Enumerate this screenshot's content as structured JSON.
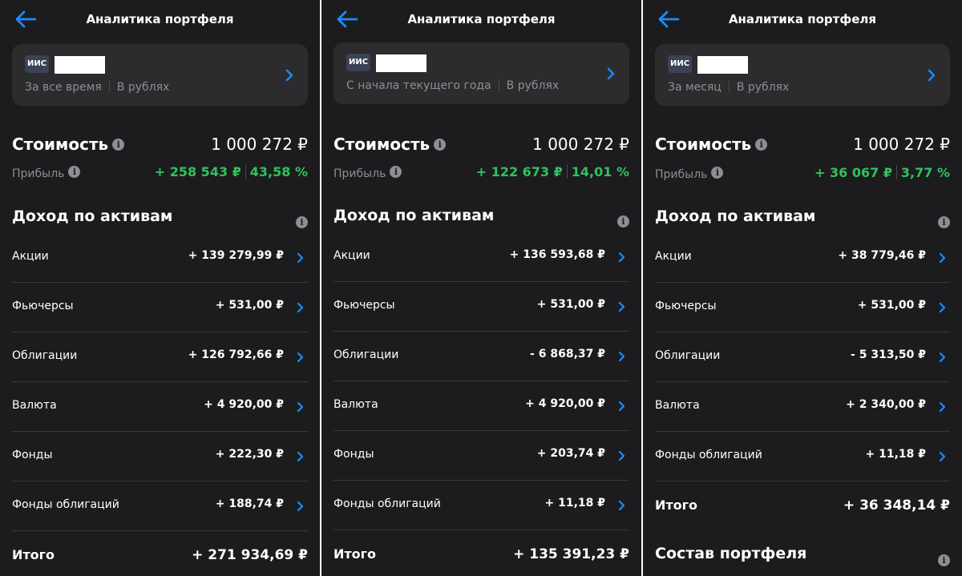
{
  "accent_color": "#1a8cff",
  "positive_color": "#30c25b",
  "icons": {
    "back": "arrow-left-icon",
    "chevron": "chevron-right-icon",
    "info": "info-icon"
  },
  "screens": [
    {
      "header_title": "Аналитика портфеля",
      "account_badge": "ИИС",
      "period": "За все время",
      "currency": "В рублях",
      "value_label": "Стоимость",
      "value": "1 000 272 ₽",
      "profit_label": "Прибыль",
      "profit_amount": "+ 258 543 ₽",
      "profit_percent": "43,58 %",
      "section_title": "Доход по активам",
      "assets": [
        {
          "name": "Акции",
          "value": "+ 139 279,99 ₽"
        },
        {
          "name": "Фьючерсы",
          "value": "+ 531,00 ₽"
        },
        {
          "name": "Облигации",
          "value": "+ 126 792,66 ₽"
        },
        {
          "name": "Валюта",
          "value": "+ 4 920,00 ₽"
        },
        {
          "name": "Фонды",
          "value": "+ 222,30 ₽"
        },
        {
          "name": "Фонды облигаций",
          "value": "+ 188,74 ₽"
        }
      ],
      "total_label": "Итого",
      "total_value": "+ 271 934,69 ₽"
    },
    {
      "header_title": "Аналитика портфеля",
      "account_badge": "ИИС",
      "period": "С начала текущего года",
      "currency": "В рублях",
      "value_label": "Стоимость",
      "value": "1 000 272 ₽",
      "profit_label": "Прибыль",
      "profit_amount": "+ 122 673 ₽",
      "profit_percent": "14,01 %",
      "section_title": "Доход по активам",
      "assets": [
        {
          "name": "Акции",
          "value": "+ 136 593,68 ₽"
        },
        {
          "name": "Фьючерсы",
          "value": "+ 531,00 ₽"
        },
        {
          "name": "Облигации",
          "value": "- 6 868,37 ₽"
        },
        {
          "name": "Валюта",
          "value": "+ 4 920,00 ₽"
        },
        {
          "name": "Фонды",
          "value": "+ 203,74 ₽"
        },
        {
          "name": "Фонды облигаций",
          "value": "+ 11,18 ₽"
        }
      ],
      "total_label": "Итого",
      "total_value": "+ 135 391,23 ₽"
    },
    {
      "header_title": "Аналитика портфеля",
      "account_badge": "ИИС",
      "period": "За месяц",
      "currency": "В рублях",
      "value_label": "Стоимость",
      "value": "1 000 272 ₽",
      "profit_label": "Прибыль",
      "profit_amount": "+ 36 067 ₽",
      "profit_percent": "3,77 %",
      "section_title": "Доход по активам",
      "assets": [
        {
          "name": "Акции",
          "value": "+ 38 779,46 ₽"
        },
        {
          "name": "Фьючерсы",
          "value": "+ 531,00 ₽"
        },
        {
          "name": "Облигации",
          "value": "- 5 313,50 ₽"
        },
        {
          "name": "Валюта",
          "value": "+ 2 340,00 ₽"
        },
        {
          "name": "Фонды облигаций",
          "value": "+ 11,18 ₽"
        }
      ],
      "total_label": "Итого",
      "total_value": "+ 36 348,14 ₽",
      "next_section_title": "Состав портфеля"
    }
  ]
}
